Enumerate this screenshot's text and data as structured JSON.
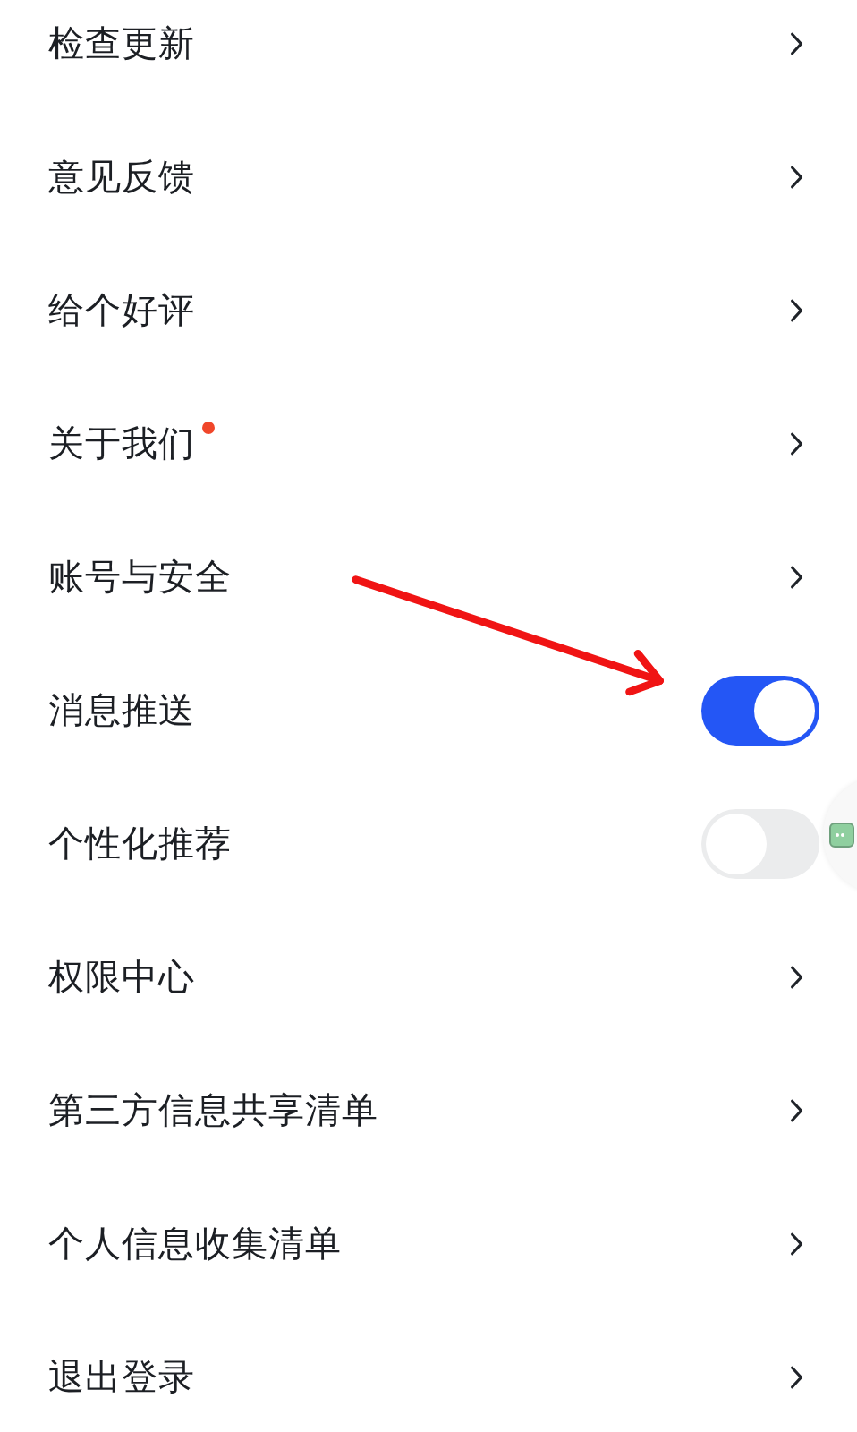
{
  "settings": [
    {
      "kind": "link",
      "label": "检查更新",
      "badge": false
    },
    {
      "kind": "link",
      "label": "意见反馈",
      "badge": false
    },
    {
      "kind": "link",
      "label": "给个好评",
      "badge": false
    },
    {
      "kind": "link",
      "label": "关于我们",
      "badge": true
    },
    {
      "kind": "link",
      "label": "账号与安全",
      "badge": false
    },
    {
      "kind": "toggle",
      "label": "消息推送",
      "on": true
    },
    {
      "kind": "toggle",
      "label": "个性化推荐",
      "on": false
    },
    {
      "kind": "link",
      "label": "权限中心",
      "badge": false
    },
    {
      "kind": "link",
      "label": "第三方信息共享清单",
      "badge": false
    },
    {
      "kind": "link",
      "label": "个人信息收集清单",
      "badge": false
    },
    {
      "kind": "link",
      "label": "退出登录",
      "badge": false
    }
  ]
}
